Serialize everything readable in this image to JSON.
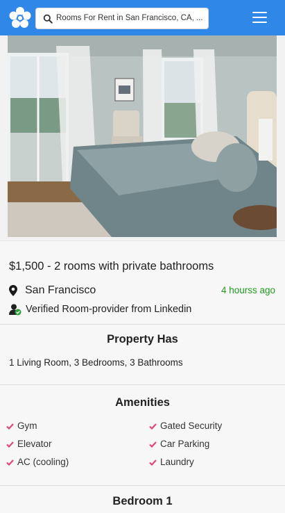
{
  "header": {
    "logo_icon": "flower-logo-icon",
    "search_icon": "search-icon",
    "search_text": "Rooms For Rent in San Francisco, CA, ...",
    "menu_icon": "hamburger-menu-icon",
    "colors": {
      "bar": "#2f88e8"
    }
  },
  "listing": {
    "photo_icon": "bedroom-photo",
    "title": "$1,500 - 2 rooms with private bathrooms",
    "location": "San Francisco",
    "location_icon": "map-pin-icon",
    "posted": "4 hourss ago",
    "verified": "Verified Room-provider from Linkedin",
    "verified_icon": "verified-user-icon",
    "colors": {
      "posted": "#1f9b1f"
    }
  },
  "property": {
    "heading": "Property Has",
    "text": "1 Living Room, 3 Bedrooms, 3 Bathrooms"
  },
  "amenities": {
    "heading": "Amenities",
    "check_icon": "check-icon",
    "check_color": "#e0457b",
    "left": [
      "Gym",
      "Elevator",
      "AC (cooling)"
    ],
    "right": [
      "Gated Security",
      "Car Parking",
      "Laundry"
    ]
  },
  "bedroom": {
    "heading": "Bedroom 1"
  }
}
